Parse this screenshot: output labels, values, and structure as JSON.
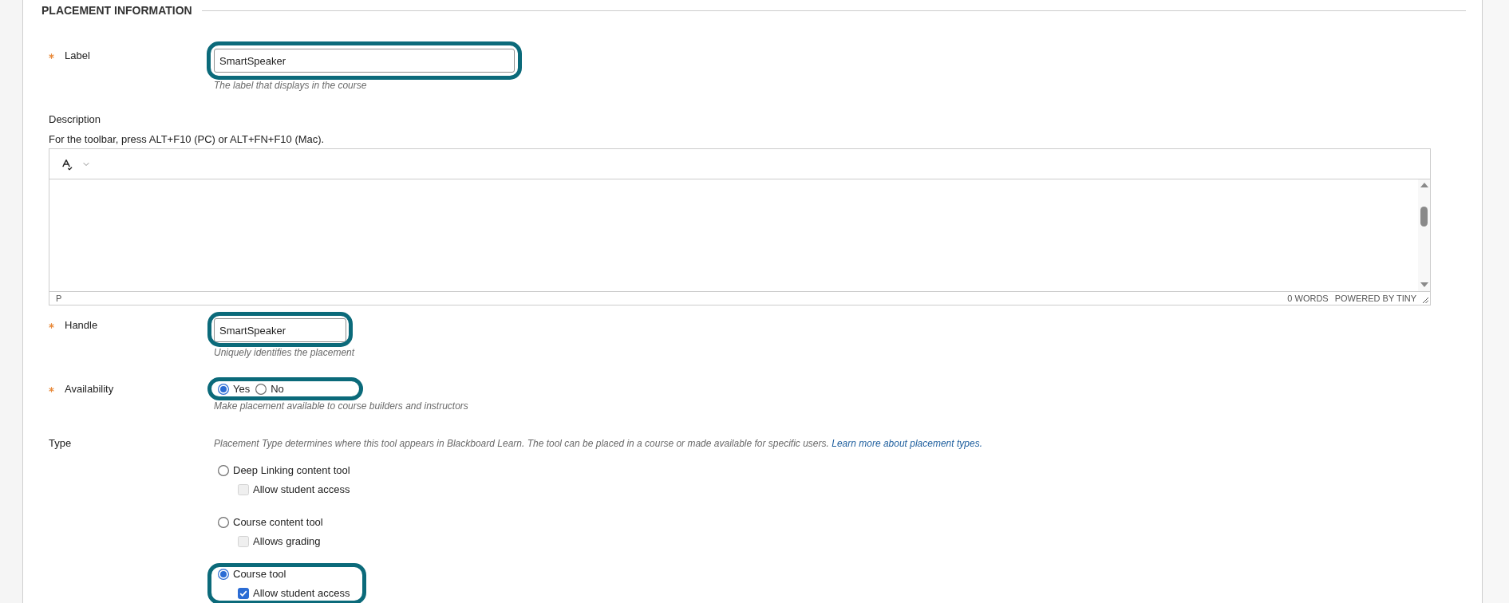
{
  "section": {
    "title": "PLACEMENT INFORMATION"
  },
  "label_field": {
    "label": "Label",
    "required": true,
    "value": "SmartSpeaker",
    "hint": "The label that displays in the course",
    "highlighted": true
  },
  "description": {
    "label": "Description",
    "required": false,
    "instructions": "For the toolbar, press ALT+F10 (PC) or ALT+FN+F10 (Mac).",
    "editor": {
      "path": "P",
      "word_count": "0 WORDS",
      "branding": "POWERED BY TINY"
    }
  },
  "handle_field": {
    "label": "Handle",
    "required": true,
    "value": "SmartSpeaker",
    "hint": "Uniquely identifies the placement",
    "highlighted": true
  },
  "availability": {
    "label": "Availability",
    "required": true,
    "highlighted": true,
    "options": [
      {
        "label": "Yes",
        "selected": true
      },
      {
        "label": "No",
        "selected": false
      }
    ],
    "hint": "Make placement available to course builders and instructors"
  },
  "type": {
    "label": "Type",
    "required": false,
    "hint": "Placement Type determines where this tool appears in Blackboard Learn. The tool can be placed in a course or made available for specific users.",
    "link": "Learn more about placement types.",
    "options": [
      {
        "label": "Deep Linking content tool",
        "selected": false,
        "highlighted": false,
        "sub_option": {
          "label": "Allow student access",
          "checked": false,
          "disabled": true
        }
      },
      {
        "label": "Course content tool",
        "selected": false,
        "highlighted": false,
        "sub_option": {
          "label": "Allows grading",
          "checked": false,
          "disabled": true
        }
      },
      {
        "label": "Course tool",
        "selected": true,
        "highlighted": true,
        "sub_option": {
          "label": "Allow student access",
          "checked": true,
          "disabled": false
        }
      }
    ]
  }
}
